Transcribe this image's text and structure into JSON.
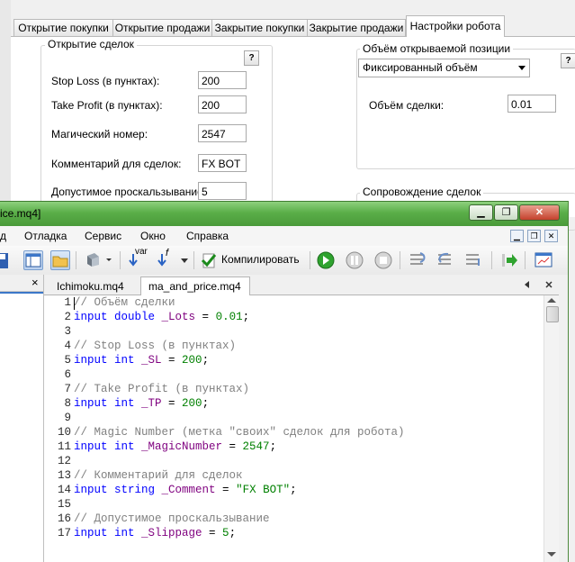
{
  "settings_dialog": {
    "tabs": [
      {
        "label": "Открытие покупки"
      },
      {
        "label": "Открытие продажи"
      },
      {
        "label": "Закрытие покупки"
      },
      {
        "label": "Закрытие продажи"
      },
      {
        "label": "Настройки робота"
      }
    ],
    "active_tab": "Настройки робота",
    "open_group": {
      "title": "Открытие сделок",
      "help": "?",
      "fields": [
        {
          "label": "Stop Loss (в пунктах):",
          "value": "200"
        },
        {
          "label": "Take Profit (в пунктах):",
          "value": "200"
        },
        {
          "label": "Магический номер:",
          "value": "2547"
        },
        {
          "label": "Комментарий для сделок:",
          "value": "FX BOT"
        },
        {
          "label": "Допустимое проскальзывание:",
          "value": "5"
        }
      ]
    },
    "volume_group": {
      "title": "Объём открываемой позиции",
      "help": "?",
      "mode": "Фиксированный объём",
      "volume_label": "Объём сделки:",
      "volume_value": "0.01"
    },
    "tracking_group": {
      "title": "Сопровождение сделок"
    }
  },
  "editor": {
    "title": "ice.mq4]",
    "menu": [
      "д",
      "Отладка",
      "Сервис",
      "Окно",
      "Справка"
    ],
    "toolbar": {
      "var_label": "var",
      "f_label": "f",
      "compile_label": "Компилировать"
    },
    "nav_close": "×",
    "file_tabs": [
      {
        "label": "Ichimoku.mq4"
      },
      {
        "label": "ma_and_price.mq4"
      }
    ],
    "active_file": "ma_and_price.mq4",
    "code_lines": [
      {
        "n": "1",
        "parts": [
          {
            "c": "cm",
            "t": "// Объём сделки"
          }
        ]
      },
      {
        "n": "2",
        "parts": [
          {
            "c": "kw",
            "t": "input double "
          },
          {
            "c": "id",
            "t": "_Lots"
          },
          {
            "c": "plain",
            "t": " = "
          },
          {
            "c": "num",
            "t": "0.01"
          },
          {
            "c": "plain",
            "t": ";"
          }
        ]
      },
      {
        "n": "3",
        "parts": []
      },
      {
        "n": "4",
        "parts": [
          {
            "c": "cm",
            "t": "// Stop Loss (в пунктах)"
          }
        ]
      },
      {
        "n": "5",
        "parts": [
          {
            "c": "kw",
            "t": "input int "
          },
          {
            "c": "id",
            "t": "_SL"
          },
          {
            "c": "plain",
            "t": " = "
          },
          {
            "c": "num",
            "t": "200"
          },
          {
            "c": "plain",
            "t": ";"
          }
        ]
      },
      {
        "n": "6",
        "parts": []
      },
      {
        "n": "7",
        "parts": [
          {
            "c": "cm",
            "t": "// Take Profit (в пунктах)"
          }
        ]
      },
      {
        "n": "8",
        "parts": [
          {
            "c": "kw",
            "t": "input int "
          },
          {
            "c": "id",
            "t": "_TP"
          },
          {
            "c": "plain",
            "t": " = "
          },
          {
            "c": "num",
            "t": "200"
          },
          {
            "c": "plain",
            "t": ";"
          }
        ]
      },
      {
        "n": "9",
        "parts": []
      },
      {
        "n": "10",
        "parts": [
          {
            "c": "cm",
            "t": "// Magic Number (метка \"своих\" сделок для робота)"
          }
        ]
      },
      {
        "n": "11",
        "parts": [
          {
            "c": "kw",
            "t": "input int "
          },
          {
            "c": "id",
            "t": "_MagicNumber"
          },
          {
            "c": "plain",
            "t": " = "
          },
          {
            "c": "num",
            "t": "2547"
          },
          {
            "c": "plain",
            "t": ";"
          }
        ]
      },
      {
        "n": "12",
        "parts": []
      },
      {
        "n": "13",
        "parts": [
          {
            "c": "cm",
            "t": "// Комментарий для сделок"
          }
        ]
      },
      {
        "n": "14",
        "parts": [
          {
            "c": "kw",
            "t": "input string "
          },
          {
            "c": "id",
            "t": "_Comment"
          },
          {
            "c": "plain",
            "t": " = "
          },
          {
            "c": "str",
            "t": "\"FX BOT\""
          },
          {
            "c": "plain",
            "t": ";"
          }
        ]
      },
      {
        "n": "15",
        "parts": []
      },
      {
        "n": "16",
        "parts": [
          {
            "c": "cm",
            "t": "// Допустимое проскальзывание"
          }
        ]
      },
      {
        "n": "17",
        "parts": [
          {
            "c": "kw",
            "t": "input int "
          },
          {
            "c": "id",
            "t": "_Slippage"
          },
          {
            "c": "plain",
            "t": " = "
          },
          {
            "c": "num",
            "t": "5"
          },
          {
            "c": "plain",
            "t": ";"
          }
        ]
      }
    ]
  }
}
